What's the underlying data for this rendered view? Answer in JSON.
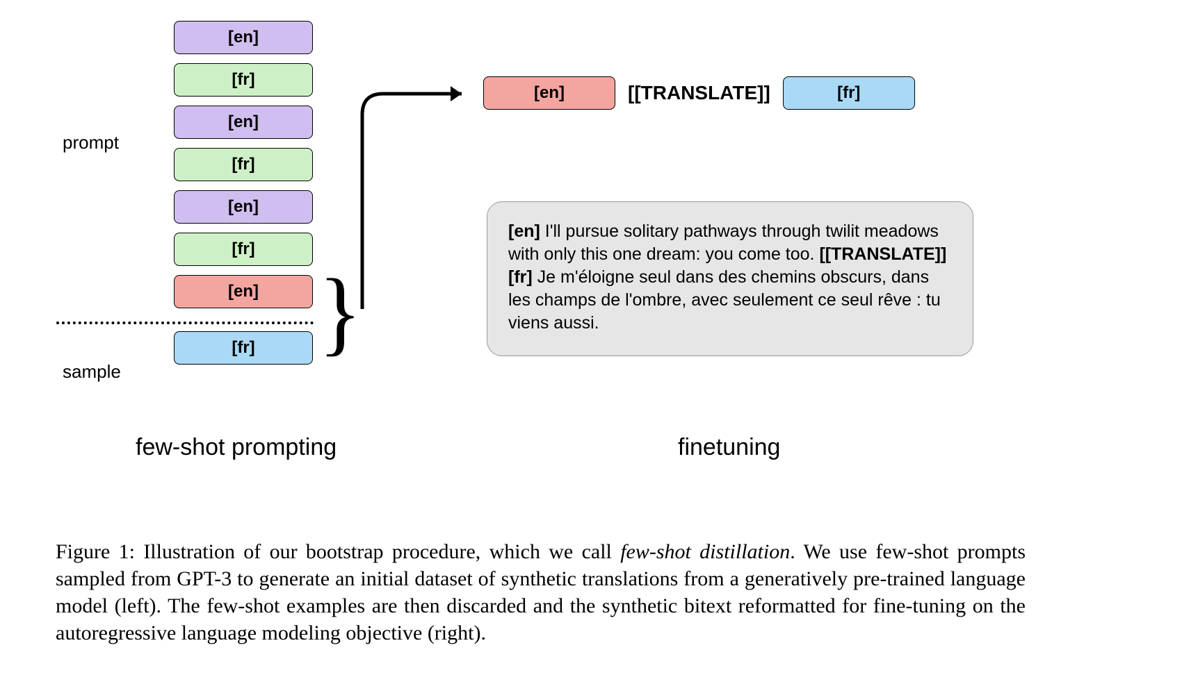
{
  "left": {
    "prompt_label": "prompt",
    "sample_label": "sample",
    "blocks": [
      {
        "text": "[en]",
        "color": "purple"
      },
      {
        "text": "[fr]",
        "color": "green"
      },
      {
        "text": "[en]",
        "color": "purple"
      },
      {
        "text": "[fr]",
        "color": "green"
      },
      {
        "text": "[en]",
        "color": "purple"
      },
      {
        "text": "[fr]",
        "color": "green"
      },
      {
        "text": "[en]",
        "color": "red"
      },
      {
        "text": "[fr]",
        "color": "blue"
      }
    ]
  },
  "right": {
    "en_block": "[en]",
    "translate_label": "[[TRANSLATE]]",
    "fr_block": "[fr]",
    "example_en_tag": "[en]",
    "example_en_text": " I'll pursue solitary pathways through twilit meadows with only this one dream: you come too. ",
    "example_translate_tag": "[[TRANSLATE]] [fr]",
    "example_fr_text": " Je m'éloigne seul dans des chemins obscurs, dans les champs de l'ombre, avec seulement ce seul rêve : tu viens aussi."
  },
  "titles": {
    "left": "few-shot prompting",
    "right": "finetuning"
  },
  "caption": {
    "fig_label": "Figure 1: ",
    "text_before_em": "Illustration of our bootstrap procedure, which we call ",
    "em_text": "few-shot distillation",
    "text_after_em": ". We use few-shot prompts sampled from GPT-3 to generate an initial dataset of synthetic translations from a generatively pre-trained language model (left). The few-shot examples are then discarded and the synthetic bitext reformatted for fine-tuning on the autoregressive language modeling objective (right)."
  }
}
